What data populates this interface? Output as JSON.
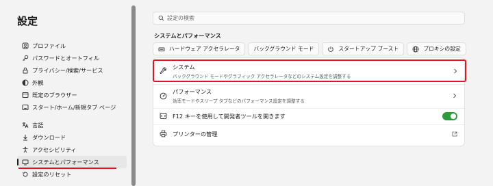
{
  "sidebar": {
    "title": "設定",
    "items": [
      {
        "label": "プロファイル",
        "icon": "profile-icon"
      },
      {
        "label": "パスワードとオートフィル",
        "icon": "key-icon"
      },
      {
        "label": "プライバシー/検索/サービス",
        "icon": "lock-icon"
      },
      {
        "label": "外観",
        "icon": "appearance-icon"
      },
      {
        "label": "既定のブラウザー",
        "icon": "browser-icon"
      },
      {
        "label": "スタート/ホーム/新規タブ ページ",
        "icon": "home-page-icon"
      },
      {
        "label": "言語",
        "icon": "language-icon"
      },
      {
        "label": "ダウンロード",
        "icon": "download-icon"
      },
      {
        "label": "アクセシビリティ",
        "icon": "accessibility-icon"
      },
      {
        "label": "システムとパフォーマンス",
        "icon": "system-icon",
        "active": true
      },
      {
        "label": "設定のリセット",
        "icon": "reset-icon"
      }
    ]
  },
  "search": {
    "placeholder": "設定の検索",
    "value": ""
  },
  "section": {
    "heading": "システムとパフォーマンス",
    "quick_links": [
      {
        "label": "ハードウェア アクセラレータ",
        "icon": "hardware-icon"
      },
      {
        "label": "バックグラウンド モード",
        "icon": "background-icon"
      },
      {
        "label": "スタートアップ ブースト",
        "icon": "power-icon"
      },
      {
        "label": "プロキシの設定",
        "icon": "globe-icon"
      }
    ],
    "rows": {
      "system": {
        "title": "システム",
        "desc": "バックグラウンド モードやグラフィック アクセラレータなどのシステム設定を調整する"
      },
      "performance": {
        "title": "パフォーマンス",
        "desc": "効率モードやスリープ タブなどのパフォーマンス設定を調整する"
      },
      "f12": {
        "title": "F12 キーを使用して開発者ツールを開きます",
        "toggle_on": true
      },
      "printer": {
        "title": "プリンターの管理"
      }
    }
  },
  "colors": {
    "accent_red": "#e0141e",
    "toggle_on": "#2e9c3d"
  }
}
